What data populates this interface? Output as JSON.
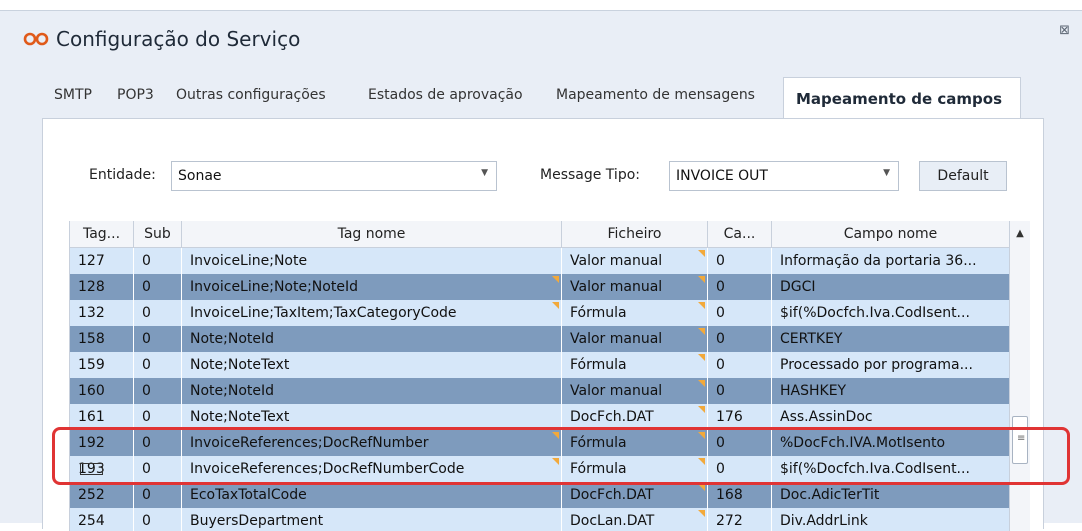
{
  "window": {
    "title": "Configuração do Serviço"
  },
  "tabs": [
    {
      "label": "SMTP"
    },
    {
      "label": "POP3"
    },
    {
      "label": "Outras configurações"
    },
    {
      "label": "Estados de aprovação"
    },
    {
      "label": "Mapeamento de mensagens"
    },
    {
      "label": "Mapeamento de campos"
    }
  ],
  "active_tab": "Mapeamento de campos",
  "filters": {
    "entidade_label": "Entidade:",
    "entidade_value": "Sonae",
    "message_tipo_label": "Message Tipo:",
    "message_tipo_value": "INVOICE OUT",
    "default_button": "Default"
  },
  "grid": {
    "columns": [
      "Tag...",
      "Sub",
      "Tag nome",
      "Ficheiro",
      "Ca...",
      "Campo nome"
    ],
    "rows": [
      [
        "127",
        "0",
        "InvoiceLine;Note",
        "Valor manual",
        "0",
        "Informação da portaria 36..."
      ],
      [
        "128",
        "0",
        "InvoiceLine;Note;NoteId",
        "Valor manual",
        "0",
        "DGCI"
      ],
      [
        "132",
        "0",
        "InvoiceLine;TaxItem;TaxCategoryCode",
        "Fórmula",
        "0",
        "$if(%Docfch.Iva.CodIsent..."
      ],
      [
        "158",
        "0",
        "Note;NoteId",
        "Valor manual",
        "0",
        "CERTKEY"
      ],
      [
        "159",
        "0",
        "Note;NoteText",
        "Fórmula",
        "0",
        "Processado por programa..."
      ],
      [
        "160",
        "0",
        "Note;NoteId",
        "Valor manual",
        "0",
        "HASHKEY"
      ],
      [
        "161",
        "0",
        "Note;NoteText",
        "DocFch.DAT",
        "176",
        "Ass.AssinDoc"
      ],
      [
        "192",
        "0",
        "InvoiceReferences;DocRefNumber",
        "Fórmula",
        "0",
        "%DocFch.IVA.MotIsento"
      ],
      [
        "193",
        "0",
        "InvoiceReferences;DocRefNumberCode",
        "Fórmula",
        "0",
        "$if(%Docfch.Iva.CodIsent..."
      ],
      [
        "252",
        "0",
        "EcoTaxTotalCode",
        "DocFch.DAT",
        "168",
        "Doc.AdicTerTit"
      ],
      [
        "254",
        "0",
        "BuyersDepartment",
        "DocLan.DAT",
        "272",
        "Div.AddrLink"
      ]
    ]
  },
  "colors": {
    "row_light": "#d6e7f9",
    "row_dark": "#7e9bbd",
    "marker": "#f2a93b",
    "highlight": "#e03434"
  }
}
